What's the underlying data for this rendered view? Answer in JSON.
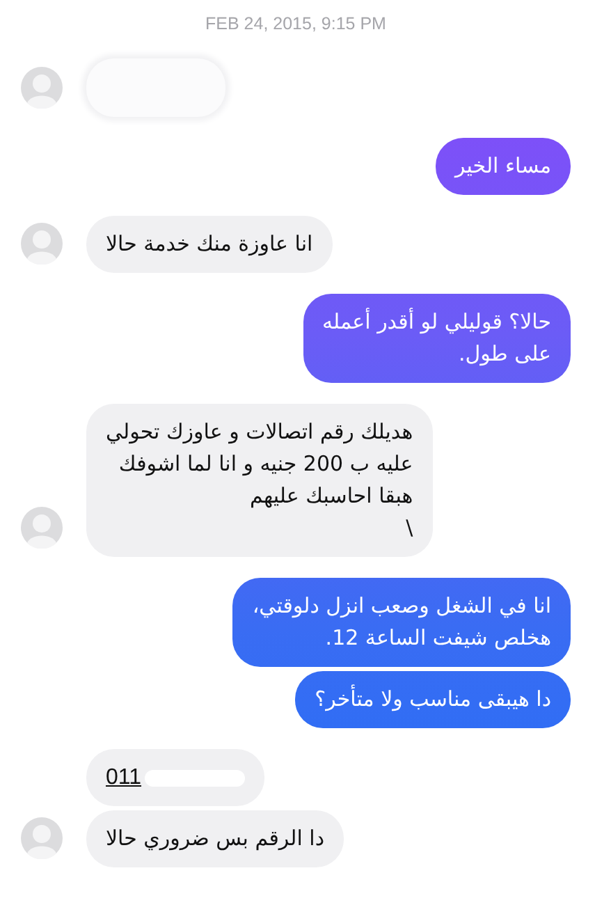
{
  "timestamp": "FEB 24, 2015, 9:15 PM",
  "groups": [
    {
      "outgoing": false,
      "messages": [
        {
          "kind": "redacted"
        }
      ]
    },
    {
      "outgoing": true,
      "messages": [
        {
          "kind": "text",
          "text": "مساء الخير"
        }
      ]
    },
    {
      "outgoing": false,
      "messages": [
        {
          "kind": "text",
          "text": "انا عاوزة منك خدمة حالا"
        }
      ]
    },
    {
      "outgoing": true,
      "messages": [
        {
          "kind": "text",
          "text": "حالا؟ قوليلي لو أقدر أعمله\nعلى طول."
        }
      ]
    },
    {
      "outgoing": false,
      "messages": [
        {
          "kind": "text",
          "text": "هديلك رقم اتصالات و عاوزك تحولي\nعليه ب 200 جنيه و انا لما اشوفك\nهبقا احاسبك عليهم\n\\"
        }
      ]
    },
    {
      "outgoing": true,
      "messages": [
        {
          "kind": "text",
          "text": "انا في الشغل وصعب انزل دلوقتي،\nهخلص شيفت الساعة 12."
        },
        {
          "kind": "text",
          "text": "دا هيبقى مناسب ولا متأخر؟"
        }
      ]
    },
    {
      "outgoing": false,
      "messages": [
        {
          "kind": "phone",
          "text": "011"
        },
        {
          "kind": "text",
          "text": "دا الرقم بس ضروري حالا"
        }
      ]
    }
  ]
}
